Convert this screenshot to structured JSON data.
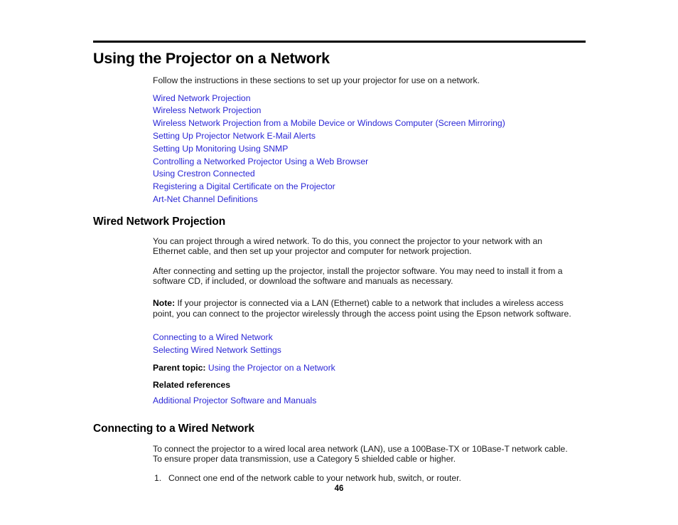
{
  "page": {
    "number": "46"
  },
  "chapter": {
    "title": "Using the Projector on a Network",
    "intro": "Follow the instructions in these sections to set up your projector for use on a network.",
    "toc_links": [
      "Wired Network Projection",
      "Wireless Network Projection",
      "Wireless Network Projection from a Mobile Device or Windows Computer (Screen Mirroring)",
      "Setting Up Projector Network E-Mail Alerts",
      "Setting Up Monitoring Using SNMP",
      "Controlling a Networked Projector Using a Web Browser",
      "Using Crestron Connected",
      "Registering a Digital Certificate on the Projector",
      "Art-Net Channel Definitions"
    ]
  },
  "section_wired": {
    "title": "Wired Network Projection",
    "paragraph_1": "You can project through a wired network. To do this, you connect the projector to your network with an Ethernet cable, and then set up your projector and computer for network projection.",
    "paragraph_2": "After connecting and setting up the projector, install the projector software. You may need to install it from a software CD, if included, or download the software and manuals as necessary.",
    "note_label": "Note:",
    "note_text": " If your projector is connected via a LAN (Ethernet) cable to a network that includes a wireless access point, you can connect to the projector wirelessly through the access point using the Epson network software.",
    "sub_links": [
      "Connecting to a Wired Network",
      "Selecting Wired Network Settings"
    ],
    "parent_topic_label": "Parent topic:",
    "parent_topic_link": "Using the Projector on a Network",
    "related_references_label": "Related references",
    "related_references_link": "Additional Projector Software and Manuals"
  },
  "section_connecting": {
    "title": "Connecting to a Wired Network",
    "paragraph_1": "To connect the projector to a wired local area network (LAN), use a 100Base-TX or 10Base-T network cable. To ensure proper data transmission, use a Category 5 shielded cable or higher.",
    "steps": [
      {
        "number": "1.",
        "text": "Connect one end of the network cable to your network hub, switch, or router."
      }
    ]
  },
  "colors": {
    "link": "#2b27d6",
    "text": "#1a1a1a",
    "rule": "#000000"
  }
}
